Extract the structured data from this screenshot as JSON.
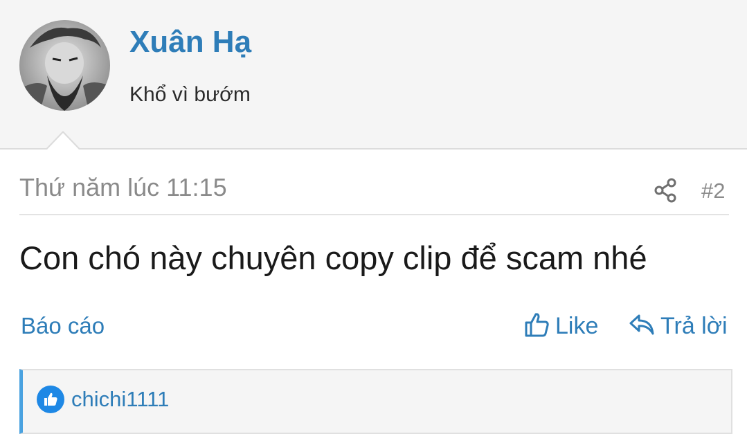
{
  "user": {
    "name": "Xuân Hạ",
    "title": "Khổ vì bướm"
  },
  "post": {
    "date": "Thứ năm lúc 11:15",
    "number": "#2",
    "body": "Con chó này chuyên copy clip để scam nhé"
  },
  "actions": {
    "report": "Báo cáo",
    "like": "Like",
    "reply": "Trả lời"
  },
  "likes": {
    "users": [
      "chichi1111"
    ]
  },
  "colors": {
    "link": "#2e7db8",
    "header_bg": "#f5f5f5",
    "like_badge": "#1e88e5",
    "likes_accent": "#4aa2e0"
  },
  "icons": {
    "share": "share-icon",
    "like": "thumbs-up-icon",
    "reply": "reply-arrow-icon",
    "avatar": "avatar"
  }
}
